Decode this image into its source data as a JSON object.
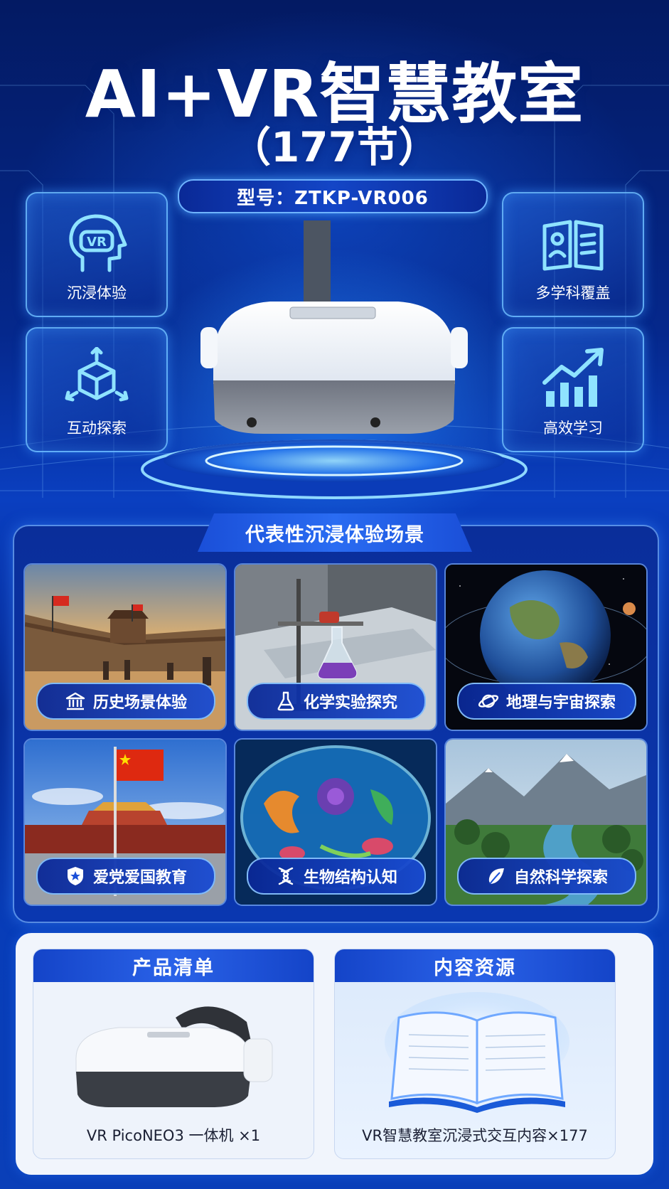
{
  "header": {
    "title": "AI+VR智慧教室",
    "subtitle": "（177节）",
    "model": "型号：ZTKP-VR006"
  },
  "features": [
    {
      "label": "沉浸体验",
      "icon": "vr-head-icon"
    },
    {
      "label": "互动探索",
      "icon": "cube-interact-icon"
    },
    {
      "label": "多学科覆盖",
      "icon": "open-book-icon"
    },
    {
      "label": "高效学习",
      "icon": "growth-chart-icon"
    }
  ],
  "scenes": {
    "title": "代表性沉浸体验场景",
    "items": [
      {
        "label": "历史场景体验",
        "icon": "museum-icon"
      },
      {
        "label": "化学实验探究",
        "icon": "flask-icon"
      },
      {
        "label": "地理与宇宙探索",
        "icon": "planet-icon"
      },
      {
        "label": "爱党爱国教育",
        "icon": "star-shield-icon"
      },
      {
        "label": "生物结构认知",
        "icon": "dna-icon"
      },
      {
        "label": "自然科学探索",
        "icon": "leaf-icon"
      }
    ]
  },
  "product_list": {
    "title": "产品清单",
    "caption": "VR PicoNEO3 一体机 ×1"
  },
  "content_resources": {
    "title": "内容资源",
    "caption": "VR智慧教室沉浸式交互内容×177"
  },
  "colors": {
    "background": "#0a3fc0",
    "accent": "#2a6cf2",
    "glow": "#6fb4ff"
  }
}
